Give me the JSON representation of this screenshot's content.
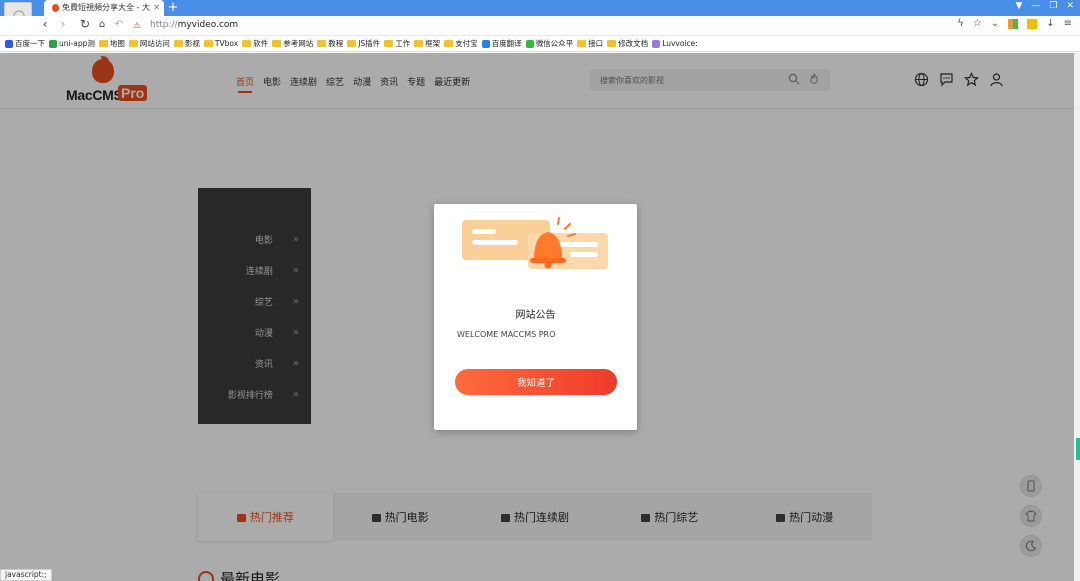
{
  "browser": {
    "tab_title": "免費短視頻分享大全 - 大",
    "new_tab": "+",
    "url_scheme": "http://",
    "url_host": "myvideo.com",
    "bookmarks": [
      {
        "label": "百度一下",
        "kind": "icon",
        "color": "#2b5ce6"
      },
      {
        "label": "uni-app测",
        "kind": "icon",
        "color": "#2aa44a"
      },
      {
        "label": "地图",
        "kind": "folder"
      },
      {
        "label": "网站访问",
        "kind": "folder"
      },
      {
        "label": "影视",
        "kind": "folder"
      },
      {
        "label": "TVbox",
        "kind": "folder"
      },
      {
        "label": "软件",
        "kind": "folder"
      },
      {
        "label": "参考网站",
        "kind": "folder"
      },
      {
        "label": "教程",
        "kind": "folder"
      },
      {
        "label": "JS插件",
        "kind": "folder"
      },
      {
        "label": "工作",
        "kind": "folder"
      },
      {
        "label": "框架",
        "kind": "folder"
      },
      {
        "label": "支付宝",
        "kind": "folder"
      },
      {
        "label": "百度翻译",
        "kind": "icon",
        "color": "#2b7de9"
      },
      {
        "label": "微信公众平",
        "kind": "icon",
        "color": "#2dbb3a"
      },
      {
        "label": "接口",
        "kind": "folder"
      },
      {
        "label": "修改文档",
        "kind": "folder"
      },
      {
        "label": "Luvvoice:",
        "kind": "icon",
        "color": "#9a7ad6"
      }
    ],
    "status_text": "javascript:;"
  },
  "site": {
    "logo_text": "MacCMS",
    "logo_badge": "Pro",
    "nav": [
      {
        "label": "首页",
        "active": true
      },
      {
        "label": "电影",
        "active": false
      },
      {
        "label": "连续剧",
        "active": false
      },
      {
        "label": "综艺",
        "active": false
      },
      {
        "label": "动漫",
        "active": false
      },
      {
        "label": "资讯",
        "active": false
      },
      {
        "label": "专题",
        "active": false
      },
      {
        "label": "最近更新",
        "active": false
      }
    ],
    "search_placeholder": "搜索你喜欢的影视",
    "side_menu": [
      {
        "label": "电影"
      },
      {
        "label": "连续剧"
      },
      {
        "label": "综艺"
      },
      {
        "label": "动漫"
      },
      {
        "label": "资讯"
      },
      {
        "label": "影视排行榜"
      }
    ],
    "side_chevron": "»",
    "hot_tabs": [
      {
        "label": "热门推荐",
        "active": true
      },
      {
        "label": "热门电影",
        "active": false
      },
      {
        "label": "热门连续剧",
        "active": false
      },
      {
        "label": "热门综艺",
        "active": false
      },
      {
        "label": "热门动漫",
        "active": false
      }
    ],
    "section_title": "最新电影"
  },
  "modal": {
    "title": "网站公告",
    "text": "WELCOME MACCMS PRO",
    "button": "我知道了"
  },
  "colors": {
    "accent": "#e8501f",
    "button_start": "#ff6b3c",
    "button_end": "#ee3a2a",
    "side_menu_bg": "#3c3c3c",
    "browser_blue": "#4a8fe7"
  }
}
